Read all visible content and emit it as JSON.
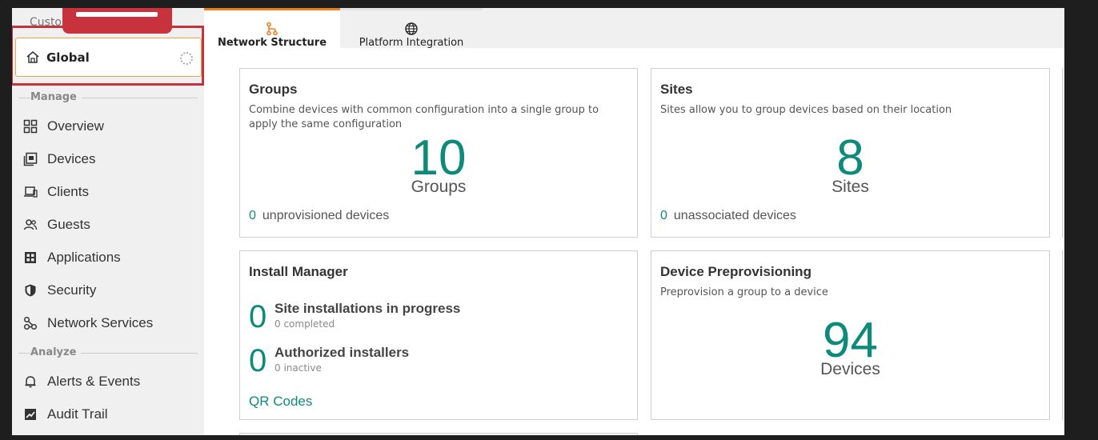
{
  "sidebar": {
    "crumb": "Custo",
    "scope_label": "Global",
    "sections": {
      "manage": "Manage",
      "analyze": "Analyze"
    },
    "items": [
      {
        "label": "Overview",
        "icon": "grid-icon"
      },
      {
        "label": "Devices",
        "icon": "devices-icon"
      },
      {
        "label": "Clients",
        "icon": "clients-icon"
      },
      {
        "label": "Guests",
        "icon": "guests-icon"
      },
      {
        "label": "Applications",
        "icon": "applications-icon"
      },
      {
        "label": "Security",
        "icon": "shield-icon"
      },
      {
        "label": "Network Services",
        "icon": "network-services-icon"
      },
      {
        "label": "Alerts & Events",
        "icon": "bell-icon"
      },
      {
        "label": "Audit Trail",
        "icon": "audit-trail-icon"
      }
    ]
  },
  "tabs": [
    {
      "label": "Network Structure",
      "icon": "network-structure-icon"
    },
    {
      "label": "Platform Integration",
      "icon": "globe-icon"
    }
  ],
  "cards": {
    "groups": {
      "title": "Groups",
      "desc": "Combine devices with common configuration into a single group to apply the same configuration",
      "count": "10",
      "unit": "Groups",
      "foot_num": "0",
      "foot_text": "unprovisioned devices"
    },
    "sites": {
      "title": "Sites",
      "desc": "Sites allow you to group devices based on their location",
      "count": "8",
      "unit": "Sites",
      "foot_num": "0",
      "foot_text": "unassociated devices"
    },
    "install": {
      "title": "Install Manager",
      "row1_num": "0",
      "row1_title": "Site installations in progress",
      "row1_sub": "0 completed",
      "row2_num": "0",
      "row2_title": "Authorized installers",
      "row2_sub": "0 inactive",
      "link": "QR Codes"
    },
    "preprov": {
      "title": "Device Preprovisioning",
      "desc": "Preprovision a group to a device",
      "count": "94",
      "unit": "Devices"
    }
  },
  "colors": {
    "accent": "#0e8a7a",
    "tab_active": "#f07a1e",
    "highlight": "#c8323c"
  }
}
